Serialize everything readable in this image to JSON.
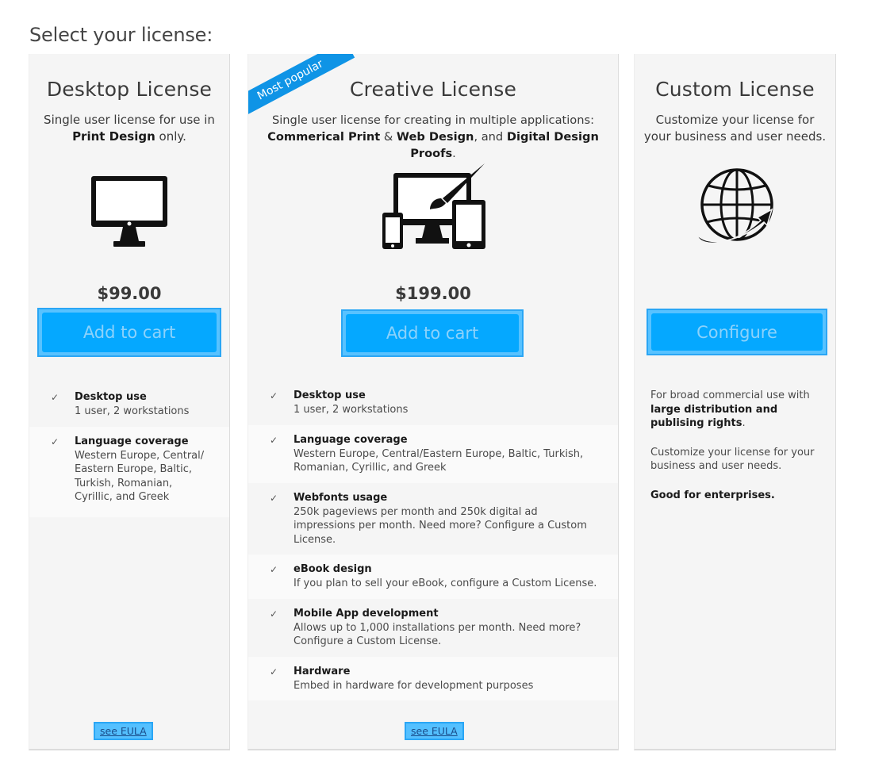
{
  "heading": "Select your license:",
  "desktop": {
    "title": "Desktop License",
    "desc_pre": "Single user license for use in ",
    "desc_bold": "Print Design",
    "desc_post": " only.",
    "price": "$99.00",
    "button": "Add to cart",
    "icon": "desktop-monitor-icon",
    "features": [
      {
        "title": "Desktop use",
        "desc": "1 user, 2 workstations"
      },
      {
        "title": "Language coverage",
        "desc": "Western Europe, Central/ Eastern Europe, Baltic, Turkish, Romanian, Cyrillic, and Greek"
      }
    ],
    "eula": "see EULA"
  },
  "creative": {
    "ribbon": "Most popular",
    "title": "Creative License",
    "desc_line1": "Single user license for creating in multiple applications:",
    "bold1": "Commerical Print",
    "amp": " & ",
    "bold2": "Web Design",
    "and": ", and ",
    "bold3": "Digital Design Proofs",
    "period": ".",
    "price": "$199.00",
    "button": "Add to cart",
    "icon": "multi-device-paintbrush-icon",
    "features": [
      {
        "title": "Desktop use",
        "desc": "1 user, 2 workstations"
      },
      {
        "title": "Language coverage",
        "desc": "Western Europe, Central/Eastern Europe, Baltic, Turkish, Romanian, Cyrillic, and Greek"
      },
      {
        "title": "Webfonts usage",
        "desc": "250k pageviews per month and 250k digital ad impressions per month. Need more? Configure a Custom License."
      },
      {
        "title": "eBook design",
        "desc": "If you plan to sell your eBook, configure a Custom License."
      },
      {
        "title": "Mobile App development",
        "desc": "Allows up to 1,000 installations per month. Need more? Configure a Custom License."
      },
      {
        "title": "Hardware",
        "desc": "Embed in hardware for development purposes"
      }
    ],
    "eula": "see EULA"
  },
  "custom": {
    "title": "Custom License",
    "desc": "Customize your license for your business and user needs.",
    "button": "Configure",
    "icon": "globe-arrow-icon",
    "p1_pre": "For broad commercial use with ",
    "p1_bold": "large distribution and publising rights",
    "p1_post": ".",
    "p2": "Customize your license for your business and user needs.",
    "p3": "Good for enterprises."
  },
  "colors": {
    "button_fill": "#05a8ff",
    "button_border": "#2aa6f5",
    "button_text": "#8cd2fb",
    "ribbon": "#0f94e6",
    "card_bg": "#f5f5f5"
  }
}
